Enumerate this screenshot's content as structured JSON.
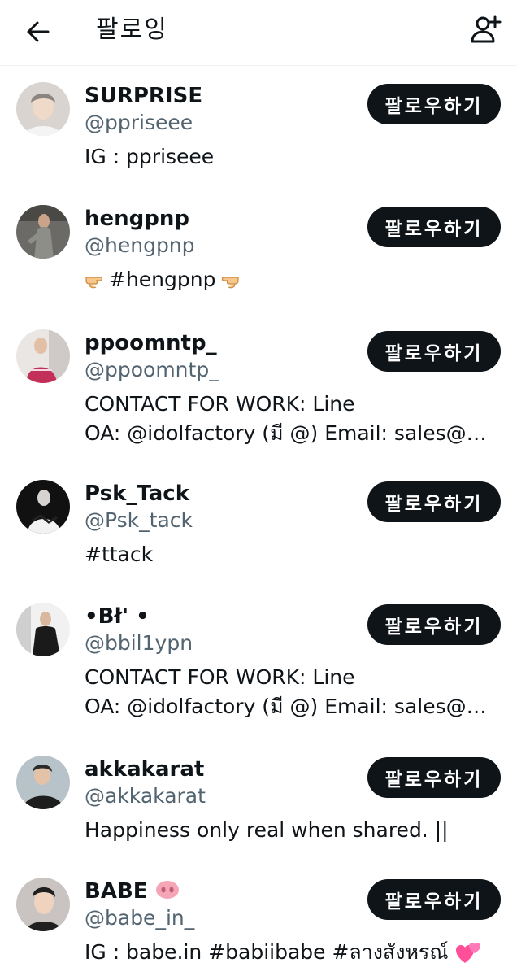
{
  "header": {
    "title": "팔로잉",
    "back_icon": "arrow-left-icon",
    "add_icon": "add-user-icon"
  },
  "accounts": [
    {
      "name": "SURPRISE",
      "handle": "@ppriseee",
      "bio_lines": [
        "IG : ppriseee"
      ],
      "follow_label": "팔로우하기",
      "avatar_icon": "person-avatar-icon"
    },
    {
      "name": "hengpnp",
      "handle": "@hengpnp",
      "bio_text": "#hengpnp",
      "bio_left_icon": "pointing-right-hand-icon",
      "bio_right_icon": "pointing-left-hand-icon",
      "follow_label": "팔로우하기",
      "avatar_icon": "person-avatar-icon"
    },
    {
      "name": "ppoomntp_",
      "handle": "@ppoomntp_",
      "bio_lines": [
        "CONTACT FOR WORK: Line",
        "OA: @idolfactory (มี @) Email: sales@id..."
      ],
      "follow_label": "팔로우하기",
      "avatar_icon": "person-avatar-icon"
    },
    {
      "name": "Psk_Tack",
      "handle": "@Psk_tack",
      "bio_lines": [
        "#ttack"
      ],
      "follow_label": "팔로우하기",
      "avatar_icon": "person-avatar-icon"
    },
    {
      "name": "•Bł' •",
      "handle": "@bbil1ypn",
      "bio_lines": [
        "CONTACT FOR WORK: Line",
        "OA: @idolfactory (มี @) Email: sales@id..."
      ],
      "follow_label": "팔로우하기",
      "avatar_icon": "person-avatar-icon"
    },
    {
      "name": "akkakarat",
      "handle": "@akkakarat",
      "bio_lines": [
        "Happiness only real when shared. ||"
      ],
      "follow_label": "팔로우하기",
      "avatar_icon": "person-avatar-icon"
    },
    {
      "name": "BABE",
      "name_icon": "pig-nose-icon",
      "handle": "@babe_in_",
      "bio_lines": [
        "IG : babe.in #babiibabe #ลางสังหรณ์"
      ],
      "bio_trailing_icon": "two-hearts-icon",
      "follow_label": "팔로우하기",
      "avatar_icon": "person-avatar-icon"
    }
  ]
}
